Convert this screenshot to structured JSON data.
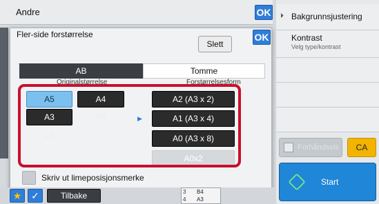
{
  "top": {
    "title": "Andre",
    "ok_label": "OK"
  },
  "side": {
    "item1": "Bakgrunnsjustering",
    "item2_title": "Kontrast",
    "item2_sub": "Velg type/kontrast",
    "faded_button": "Forhåndsvis",
    "ca_label": "CA",
    "start_label": "Start"
  },
  "dialog": {
    "title": "Fler-side forstørrelse",
    "ok_label": "OK",
    "delete_label": "Slett",
    "tabs": [
      "AB",
      "Tomme"
    ],
    "original_header": "Originalstørrelse",
    "output_header": "Forstørrelsesform",
    "original_sizes": [
      "A5",
      "A4",
      "A3",
      "B5",
      "A3"
    ],
    "output_sizes": [
      "A2 (A3 x 2)",
      "A1 (A3 x 4)",
      "A0 (A3 x 8)",
      "A0x2"
    ],
    "checkbox_label": "Skriv ut limeposisjonsmerke"
  },
  "bottom": {
    "back_label": "Tilbake",
    "preview_top": "B4",
    "preview_bottom": "A3"
  },
  "colors": {
    "highlight": "#c8102e",
    "accent": "#2f7ed8",
    "selected": "#7cc0ef"
  }
}
